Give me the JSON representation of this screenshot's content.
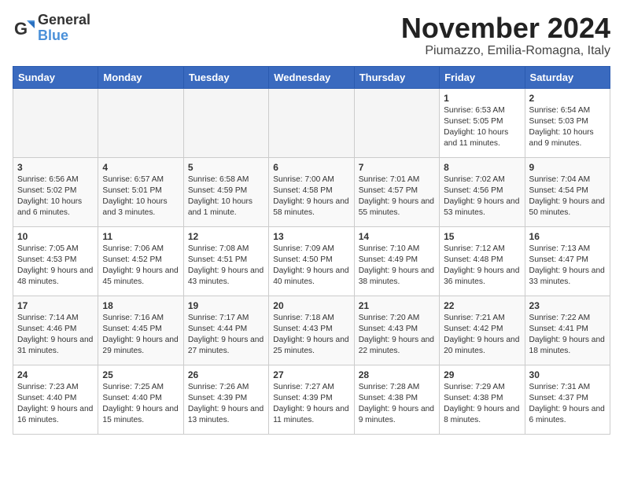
{
  "logo": {
    "line1": "General",
    "line2": "Blue"
  },
  "title": "November 2024",
  "location": "Piumazzo, Emilia-Romagna, Italy",
  "weekdays": [
    "Sunday",
    "Monday",
    "Tuesday",
    "Wednesday",
    "Thursday",
    "Friday",
    "Saturday"
  ],
  "weeks": [
    [
      {
        "day": "",
        "info": ""
      },
      {
        "day": "",
        "info": ""
      },
      {
        "day": "",
        "info": ""
      },
      {
        "day": "",
        "info": ""
      },
      {
        "day": "",
        "info": ""
      },
      {
        "day": "1",
        "info": "Sunrise: 6:53 AM\nSunset: 5:05 PM\nDaylight: 10 hours and 11 minutes."
      },
      {
        "day": "2",
        "info": "Sunrise: 6:54 AM\nSunset: 5:03 PM\nDaylight: 10 hours and 9 minutes."
      }
    ],
    [
      {
        "day": "3",
        "info": "Sunrise: 6:56 AM\nSunset: 5:02 PM\nDaylight: 10 hours and 6 minutes."
      },
      {
        "day": "4",
        "info": "Sunrise: 6:57 AM\nSunset: 5:01 PM\nDaylight: 10 hours and 3 minutes."
      },
      {
        "day": "5",
        "info": "Sunrise: 6:58 AM\nSunset: 4:59 PM\nDaylight: 10 hours and 1 minute."
      },
      {
        "day": "6",
        "info": "Sunrise: 7:00 AM\nSunset: 4:58 PM\nDaylight: 9 hours and 58 minutes."
      },
      {
        "day": "7",
        "info": "Sunrise: 7:01 AM\nSunset: 4:57 PM\nDaylight: 9 hours and 55 minutes."
      },
      {
        "day": "8",
        "info": "Sunrise: 7:02 AM\nSunset: 4:56 PM\nDaylight: 9 hours and 53 minutes."
      },
      {
        "day": "9",
        "info": "Sunrise: 7:04 AM\nSunset: 4:54 PM\nDaylight: 9 hours and 50 minutes."
      }
    ],
    [
      {
        "day": "10",
        "info": "Sunrise: 7:05 AM\nSunset: 4:53 PM\nDaylight: 9 hours and 48 minutes."
      },
      {
        "day": "11",
        "info": "Sunrise: 7:06 AM\nSunset: 4:52 PM\nDaylight: 9 hours and 45 minutes."
      },
      {
        "day": "12",
        "info": "Sunrise: 7:08 AM\nSunset: 4:51 PM\nDaylight: 9 hours and 43 minutes."
      },
      {
        "day": "13",
        "info": "Sunrise: 7:09 AM\nSunset: 4:50 PM\nDaylight: 9 hours and 40 minutes."
      },
      {
        "day": "14",
        "info": "Sunrise: 7:10 AM\nSunset: 4:49 PM\nDaylight: 9 hours and 38 minutes."
      },
      {
        "day": "15",
        "info": "Sunrise: 7:12 AM\nSunset: 4:48 PM\nDaylight: 9 hours and 36 minutes."
      },
      {
        "day": "16",
        "info": "Sunrise: 7:13 AM\nSunset: 4:47 PM\nDaylight: 9 hours and 33 minutes."
      }
    ],
    [
      {
        "day": "17",
        "info": "Sunrise: 7:14 AM\nSunset: 4:46 PM\nDaylight: 9 hours and 31 minutes."
      },
      {
        "day": "18",
        "info": "Sunrise: 7:16 AM\nSunset: 4:45 PM\nDaylight: 9 hours and 29 minutes."
      },
      {
        "day": "19",
        "info": "Sunrise: 7:17 AM\nSunset: 4:44 PM\nDaylight: 9 hours and 27 minutes."
      },
      {
        "day": "20",
        "info": "Sunrise: 7:18 AM\nSunset: 4:43 PM\nDaylight: 9 hours and 25 minutes."
      },
      {
        "day": "21",
        "info": "Sunrise: 7:20 AM\nSunset: 4:43 PM\nDaylight: 9 hours and 22 minutes."
      },
      {
        "day": "22",
        "info": "Sunrise: 7:21 AM\nSunset: 4:42 PM\nDaylight: 9 hours and 20 minutes."
      },
      {
        "day": "23",
        "info": "Sunrise: 7:22 AM\nSunset: 4:41 PM\nDaylight: 9 hours and 18 minutes."
      }
    ],
    [
      {
        "day": "24",
        "info": "Sunrise: 7:23 AM\nSunset: 4:40 PM\nDaylight: 9 hours and 16 minutes."
      },
      {
        "day": "25",
        "info": "Sunrise: 7:25 AM\nSunset: 4:40 PM\nDaylight: 9 hours and 15 minutes."
      },
      {
        "day": "26",
        "info": "Sunrise: 7:26 AM\nSunset: 4:39 PM\nDaylight: 9 hours and 13 minutes."
      },
      {
        "day": "27",
        "info": "Sunrise: 7:27 AM\nSunset: 4:39 PM\nDaylight: 9 hours and 11 minutes."
      },
      {
        "day": "28",
        "info": "Sunrise: 7:28 AM\nSunset: 4:38 PM\nDaylight: 9 hours and 9 minutes."
      },
      {
        "day": "29",
        "info": "Sunrise: 7:29 AM\nSunset: 4:38 PM\nDaylight: 9 hours and 8 minutes."
      },
      {
        "day": "30",
        "info": "Sunrise: 7:31 AM\nSunset: 4:37 PM\nDaylight: 9 hours and 6 minutes."
      }
    ]
  ]
}
